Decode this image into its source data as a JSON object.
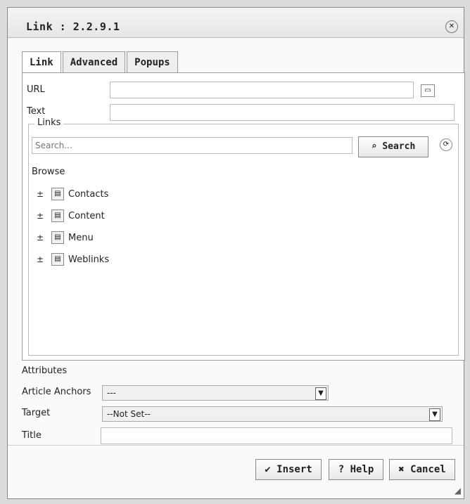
{
  "dialog": {
    "title": "Link : 2.2.9.1",
    "close_icon": "close-icon"
  },
  "tabs": [
    {
      "label": "Link",
      "active": true
    },
    {
      "label": "Advanced",
      "active": false
    },
    {
      "label": "Popups",
      "active": false
    }
  ],
  "link_tab": {
    "url_label": "URL",
    "url_value": "",
    "text_label": "Text",
    "text_value": "",
    "links_legend": "Links",
    "search_placeholder": "Search...",
    "search_button": "Search",
    "browse_label": "Browse",
    "tree": [
      {
        "label": "Contacts"
      },
      {
        "label": "Content"
      },
      {
        "label": "Menu"
      },
      {
        "label": "Weblinks"
      }
    ]
  },
  "attributes": {
    "heading": "Attributes",
    "article_anchors_label": "Article Anchors",
    "article_anchors_value": "---",
    "target_label": "Target",
    "target_value": "--Not Set--",
    "title_label": "Title",
    "title_value": ""
  },
  "buttons": {
    "insert": "Insert",
    "help": "Help",
    "cancel": "Cancel"
  }
}
